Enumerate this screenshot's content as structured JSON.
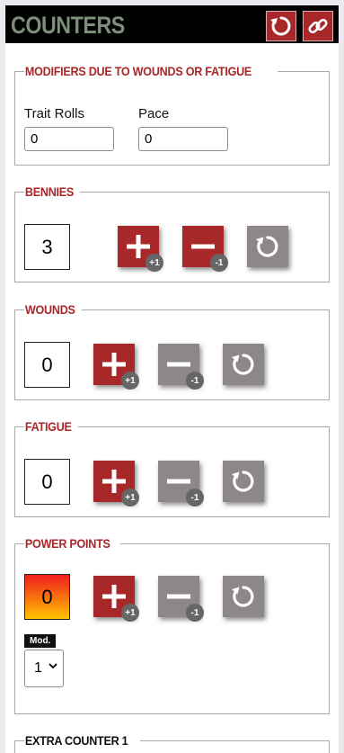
{
  "header": {
    "title": "COUNTERS",
    "reset_icon": "reset-icon",
    "link_icon": "link-icon"
  },
  "modifiers": {
    "legend": "MODIFIERS DUE TO WOUNDS OR FATIGUE",
    "trait_label": "Trait Rolls",
    "trait_value": "0",
    "pace_label": "Pace",
    "pace_value": "0"
  },
  "bennies": {
    "legend": "BENNIES",
    "value": "3",
    "plus_badge": "+1",
    "minus_badge": "-1"
  },
  "wounds": {
    "legend": "WOUNDS",
    "value": "0",
    "plus_badge": "+1",
    "minus_badge": "-1"
  },
  "fatigue": {
    "legend": "FATIGUE",
    "value": "0",
    "plus_badge": "+1",
    "minus_badge": "-1"
  },
  "power_points": {
    "legend": "POWER POINTS",
    "value": "0",
    "plus_badge": "+1",
    "minus_badge": "-1",
    "mod_label": "Mod.",
    "mod_value": "1"
  },
  "extra_counter": {
    "legend": "EXTRA COUNTER 1"
  },
  "colors": {
    "accent_red": "#a8282a",
    "disabled_gray": "#8e8787",
    "header_bg": "#000000",
    "title_green": "#7d8f7a"
  }
}
